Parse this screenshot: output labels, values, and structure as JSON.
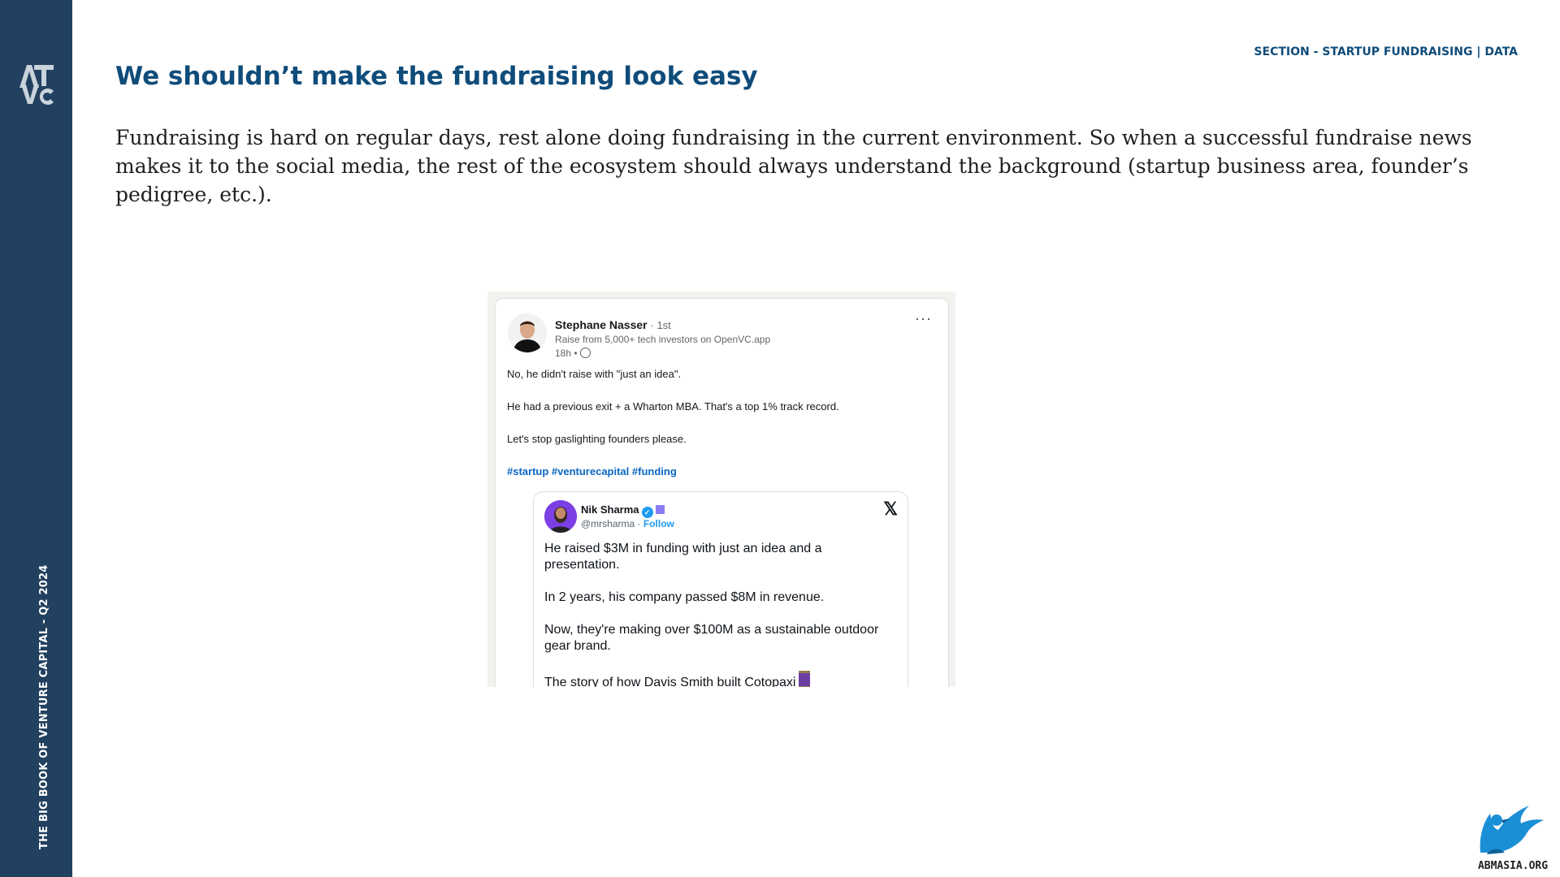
{
  "sidebar": {
    "logo_text": "ATVC",
    "vertical_text": "THE BIG BOOK OF VENTURE CAPITAL - Q2 2024",
    "background_color": "#22405f"
  },
  "header": {
    "section_label": "SECTION - STARTUP FUNDRAISING | DATA",
    "title": "We shouldn’t make the fundraising look easy"
  },
  "body": {
    "paragraph": "Fundraising is hard on regular days, rest alone doing fundraising in the current environment. So when a successful fundraise news makes it to the social media, the rest of the ecosystem should always understand the background (startup business area, founder’s pedigree, etc.)."
  },
  "linkedin_post": {
    "author_name": "Stephane Nasser",
    "connection_degree": "· 1st",
    "headline": "Raise from 5,000+ tech investors on OpenVC.app",
    "time": "18h •",
    "more_icon": "more-horizontal-icon",
    "lines": [
      "No, he didn't raise with \"just an idea\".",
      "He had a previous exit + a Wharton MBA. That's a top 1% track record.",
      "Let's stop gaslighting founders please."
    ],
    "hashtags": "#startup #venturecapital #funding",
    "link_color": "#0a66c2"
  },
  "embedded_tweet": {
    "author_name": "Nik Sharma",
    "handle": "@mrsharma ·",
    "follow_label": "Follow",
    "platform_icon": "x-logo-icon",
    "lines": [
      "He raised $3M in funding with just an idea and a",
      "presentation.",
      "In 2 years, his company passed $8M in revenue.",
      "Now, they're making over $100M as a sustainable outdoor",
      "gear brand.",
      "The story of how Davis Smith built Cotopaxi"
    ],
    "accent_color": "#1d9bf0"
  },
  "footer": {
    "logo_text": "ABMASIA.ORG",
    "logo_color": "#1b8fd6"
  }
}
